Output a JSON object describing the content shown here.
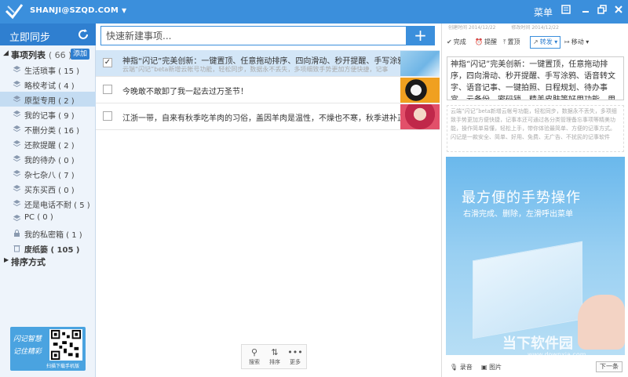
{
  "titlebar": {
    "account": "SHANJI@SZQD.COM",
    "menu": "菜单",
    "icons": [
      "note-icon",
      "minimize-icon",
      "restore-icon",
      "close-icon"
    ]
  },
  "sidebar": {
    "sync_label": "立即同步",
    "list_title": "事项列表",
    "list_count": "( 66 )",
    "add_label": "添加",
    "categories": [
      {
        "label": "生活琐事 ( 15 )",
        "icon": "layers-icon"
      },
      {
        "label": "略校考试 ( 4 )",
        "icon": "layers-icon"
      },
      {
        "label": "原型专用 ( 2 )",
        "icon": "layers-icon",
        "selected": true
      },
      {
        "label": "我的记事 ( 9 )",
        "icon": "layers-icon"
      },
      {
        "label": "不删分类 ( 16 )",
        "icon": "layers-icon"
      },
      {
        "label": "还款提醒 ( 2 )",
        "icon": "layers-icon"
      },
      {
        "label": "我的待办 ( 0 )",
        "icon": "layers-icon"
      },
      {
        "label": "杂七杂八 ( 7 )",
        "icon": "layers-icon"
      },
      {
        "label": "买东买西 ( 0 )",
        "icon": "layers-icon"
      },
      {
        "label": "还是电话不耐 ( 5 )",
        "icon": "layers-icon"
      },
      {
        "label": "PC ( 0 )",
        "icon": "layers-icon"
      },
      {
        "label": "我的私密箱 ( 1 )",
        "icon": "lock-icon"
      },
      {
        "label": "废纸篓 ( 105 )",
        "icon": "trash-icon",
        "bold": true
      }
    ],
    "sort_title": "排序方式",
    "qr_text": [
      "闪记智慧",
      "记住精彩"
    ],
    "qr_caption": "扫描下载手机版"
  },
  "middle": {
    "search_placeholder": "快速新建事项...",
    "add_symbol": "+",
    "todos": [
      {
        "title": "神指“闪记”完美创新：一键置顶、任意拖动排序、四向滑动、秒开提醒、手写涂鸦",
        "subtitle": "云端“闪记”beta新增云帐号功能，轻松同步，数据永不丢失，多项细致手势更加方便快捷，记事",
        "checked": true
      },
      {
        "title": "今晚敢不敢卸了我一起去过万圣节！",
        "subtitle": "",
        "checked": false
      },
      {
        "title": "江浙一带，自来有秋季吃羊肉的习俗，盖因羊肉是温性，不燥也不寒，秋季进补正合适",
        "subtitle": "",
        "checked": false
      }
    ],
    "tools": [
      {
        "icon": "search-icon",
        "glyph": "⚲",
        "label": "搜索"
      },
      {
        "icon": "sort-icon",
        "glyph": "⇅",
        "label": "排序"
      },
      {
        "icon": "more-icon",
        "glyph": "•••",
        "label": "更多"
      }
    ]
  },
  "detail": {
    "meta_created": "创建时间  2014/12/22",
    "meta_modified": "修改时间  2014/12/22",
    "actions": [
      {
        "label": "完成",
        "glyph": "✔"
      },
      {
        "label": "提醒",
        "glyph": "⏰"
      },
      {
        "label": "置顶",
        "glyph": "⤒"
      },
      {
        "label": "转发",
        "glyph": "↗"
      },
      {
        "label": "移动",
        "glyph": "↦"
      }
    ],
    "note_text": "神指“闪记”完美创新：一键置顶，任意拖动排序，四向滑动、秒开提醒、手写涂鸦、语音转文字、语音记事、一键拍照、日程规划、待办事宜、云备份、密码锁、精美皮肤等好用功能，用其心赢用户！",
    "note_gray": "云端“闪记”beta新增云帐号功能，轻松同步，数据永不丢失，多项细致手势更加方便快捷，记事本还可通过各分类管理备忘事项等精美功能，操作简单易懂，轻松上手，带你体验最简单、方便的记事方式。闪记是一款安全、简单、好用、免费、无广告、不扰民的记事软件",
    "preview_heading": "最方便的手势操作",
    "preview_sub": "右滑完成、删除，左滑呼出菜单",
    "record_label": "录音",
    "picture_label": "图片",
    "next_label": "下一条"
  },
  "watermark": {
    "main": "当下软件园",
    "sub": "www.downxia.com"
  }
}
